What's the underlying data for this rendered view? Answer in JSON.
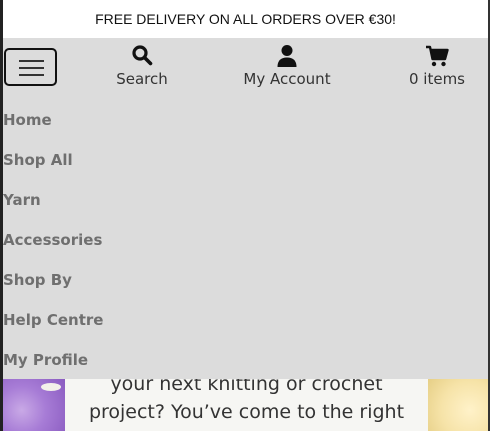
{
  "banner": {
    "text": "FREE DELIVERY ON ALL ORDERS OVER €30!"
  },
  "header": {
    "menu_toggle_icon": "hamburger-menu-icon",
    "search": {
      "label": "Search",
      "icon": "search-icon"
    },
    "account": {
      "label": "My Account",
      "icon": "user-icon"
    },
    "bag": {
      "label": "0 items",
      "icon": "cart-icon"
    }
  },
  "menu": {
    "items": [
      {
        "label": "Home"
      },
      {
        "label": "Shop All"
      },
      {
        "label": "Yarn"
      },
      {
        "label": "Accessories"
      },
      {
        "label": "Shop By"
      },
      {
        "label": "Help Centre"
      },
      {
        "label": "My Profile"
      }
    ]
  },
  "hero": {
    "line1": "your next knitting or crochet",
    "line2": "project? You’ve come to the right"
  },
  "colors": {
    "nav_background": "#dcdcdc",
    "menu_text": "#6f6f6f",
    "header_text": "#333333"
  }
}
